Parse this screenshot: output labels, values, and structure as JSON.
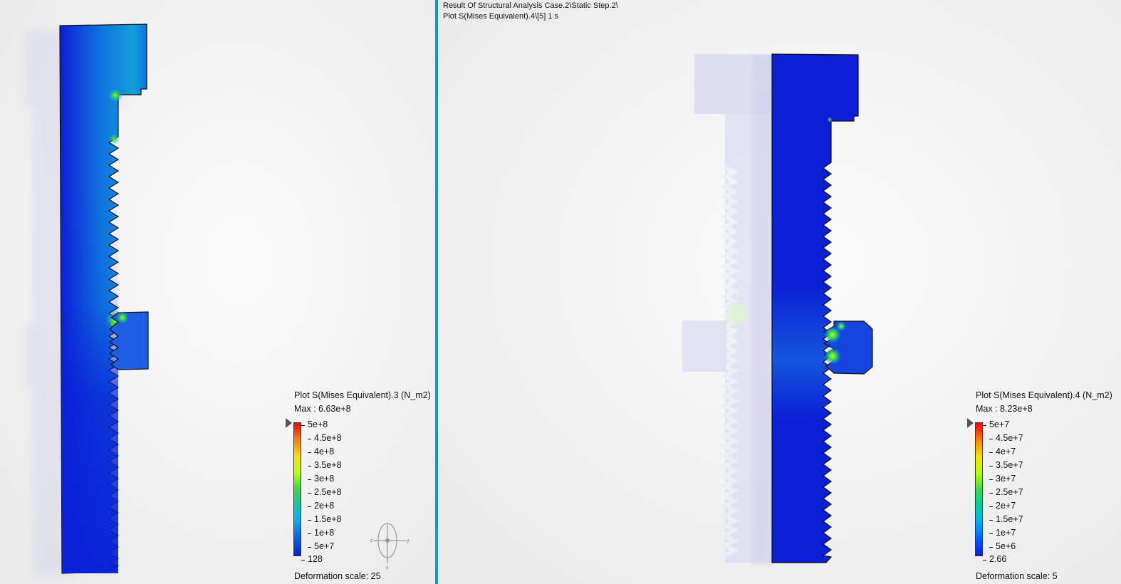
{
  "header": {
    "line1": "Result Of Structural Analysis Case.2\\Static Step.2\\",
    "line2": "Plot S(Mises Equivalent).4\\[5]    1 s"
  },
  "left_view": {
    "legend_title": "Plot S(Mises Equivalent).3 (N_m2)",
    "max_label": "Max : 6.63e+8",
    "ticks": [
      "5e+8",
      "4.5e+8",
      "4e+8",
      "3.5e+8",
      "3e+8",
      "2.5e+8",
      "2e+8",
      "1.5e+8",
      "1e+8",
      "5e+7",
      "128"
    ],
    "deformation_label": "Deformation scale: 25"
  },
  "right_view": {
    "legend_title": "Plot S(Mises Equivalent).4 (N_m2)",
    "max_label": "Max : 8.23e+8",
    "ticks": [
      "5e+7",
      "4.5e+7",
      "4e+7",
      "3.5e+7",
      "3e+7",
      "2.5e+7",
      "2e+7",
      "1.5e+7",
      "1e+7",
      "5e+6",
      "2.66"
    ],
    "deformation_label": "Deformation scale: 5"
  },
  "colors": {
    "divider": "#1f9aa6",
    "mesh_blue": "#0a1fd6",
    "stress_cyan": "#10a8e0",
    "stress_green": "#3ad94a",
    "ghost": "#d6d8f0"
  },
  "icons": {
    "compass": "axis-compass-icon"
  }
}
